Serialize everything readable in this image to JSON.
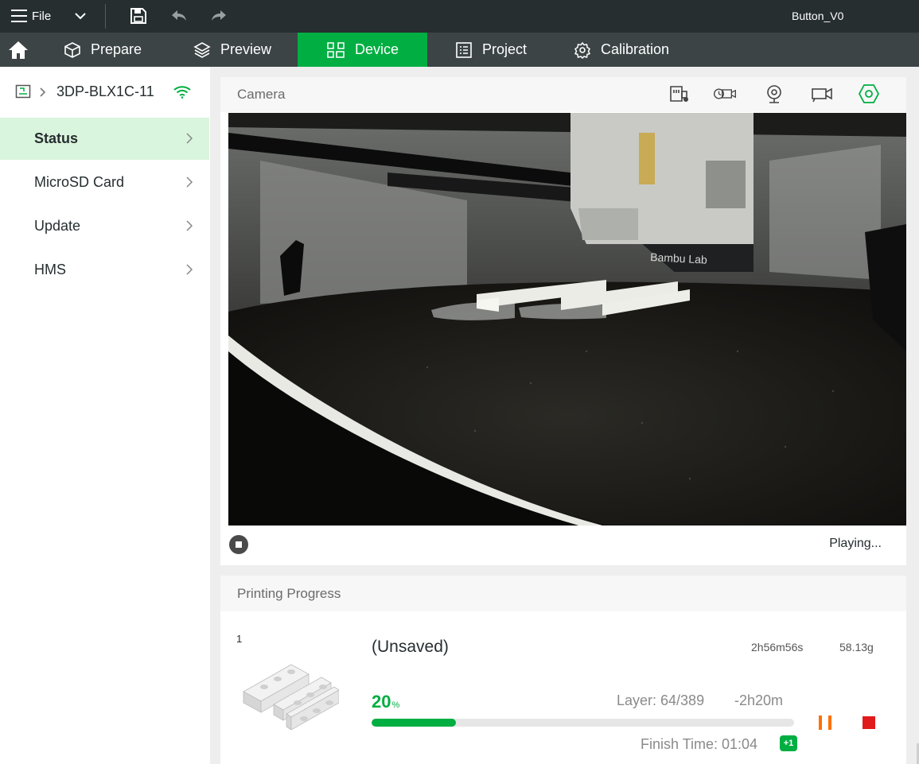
{
  "titlebar": {
    "file_label": "File",
    "project_name": "Button_V0"
  },
  "nav": {
    "tabs": [
      "Prepare",
      "Preview",
      "Device",
      "Project",
      "Calibration"
    ],
    "active_index": 2,
    "accent": "#00ae42"
  },
  "device": {
    "name": "3DP-BLX1C-11"
  },
  "sidebar": {
    "items": [
      "Status",
      "MicroSD Card",
      "Update",
      "HMS"
    ],
    "active_index": 0
  },
  "camera": {
    "title": "Camera",
    "overlay_brand": "Bambu Lab",
    "status_text": "Playing..."
  },
  "progress": {
    "title": "Printing Progress",
    "plate_number": "1",
    "job_name": "(Unsaved)",
    "total_time": "2h56m56s",
    "weight": "58.13g",
    "percent": "20",
    "percent_unit": "%",
    "percent_value": 0.2,
    "layer": "Layer: 64/389",
    "remaining": "-2h20m",
    "finish_time": "Finish Time: 01:04",
    "day_offset": "+1"
  }
}
